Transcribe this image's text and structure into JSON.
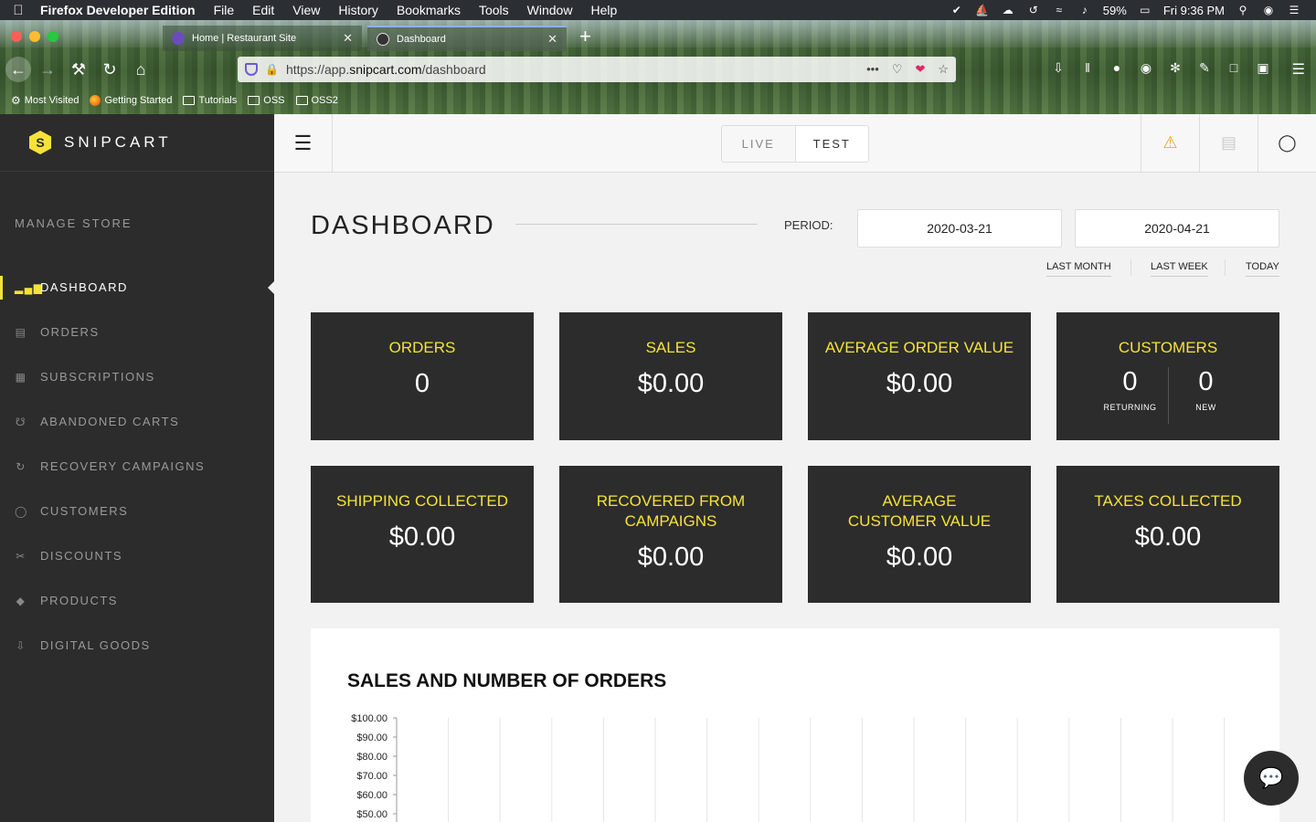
{
  "menubar": {
    "app_name": "Firefox Developer Edition",
    "menus": [
      "File",
      "Edit",
      "View",
      "History",
      "Bookmarks",
      "Tools",
      "Window",
      "Help"
    ],
    "battery": "59%",
    "clock": "Fri 9:36 PM"
  },
  "browser": {
    "tabs": [
      {
        "title": "Home | Restaurant Site",
        "active": false
      },
      {
        "title": "Dashboard",
        "active": true
      }
    ],
    "url_prefix": "https://app.",
    "url_domain": "snipcart.com",
    "url_path": "/dashboard",
    "bookmarks": [
      "Most Visited",
      "Getting Started",
      "Tutorials",
      "OSS",
      "OSS2"
    ]
  },
  "brand": {
    "name": "SNIPCART"
  },
  "sidebar": {
    "section": "MANAGE STORE",
    "items": [
      {
        "label": "DASHBOARD",
        "icon": "bar-chart-icon"
      },
      {
        "label": "ORDERS",
        "icon": "receipt-icon"
      },
      {
        "label": "SUBSCRIPTIONS",
        "icon": "calendar-icon"
      },
      {
        "label": "ABANDONED CARTS",
        "icon": "cart-icon"
      },
      {
        "label": "RECOVERY CAMPAIGNS",
        "icon": "refresh-icon"
      },
      {
        "label": "CUSTOMERS",
        "icon": "user-icon"
      },
      {
        "label": "DISCOUNTS",
        "icon": "scissors-icon"
      },
      {
        "label": "PRODUCTS",
        "icon": "tag-icon"
      },
      {
        "label": "DIGITAL GOODS",
        "icon": "download-icon"
      }
    ]
  },
  "topbar": {
    "mode_live": "LIVE",
    "mode_test": "TEST",
    "selected_mode": "TEST"
  },
  "dashboard": {
    "title": "DASHBOARD",
    "period_label": "PERIOD:",
    "start_date": "2020-03-21",
    "end_date": "2020-04-21",
    "quick_ranges": [
      "LAST MONTH",
      "LAST WEEK",
      "TODAY"
    ],
    "cards": {
      "orders": {
        "label": "ORDERS",
        "value": "0"
      },
      "sales": {
        "label": "SALES",
        "value": "$0.00"
      },
      "avg_order": {
        "label": "AVERAGE ORDER VALUE",
        "value": "$0.00"
      },
      "customers": {
        "label": "CUSTOMERS",
        "returning": "0",
        "returning_label": "RETURNING",
        "new": "0",
        "new_label": "NEW"
      },
      "shipping": {
        "label": "SHIPPING COLLECTED",
        "value": "$0.00"
      },
      "recovered": {
        "label": "RECOVERED FROM CAMPAIGNS",
        "value": "$0.00"
      },
      "avg_customer": {
        "label": "AVERAGE CUSTOMER VALUE",
        "value": "$0.00"
      },
      "taxes": {
        "label": "TAXES COLLECTED",
        "value": "$0.00"
      }
    }
  },
  "chart_data": {
    "type": "bar",
    "title": "SALES AND NUMBER OF ORDERS",
    "y_ticks": [
      "$100.00",
      "$90.00",
      "$80.00",
      "$70.00",
      "$60.00",
      "$50.00"
    ],
    "ylim": [
      50,
      100
    ],
    "values": [],
    "grid": true
  },
  "colors": {
    "accent": "#f5e33a",
    "sidebar_bg": "#2c2c2c",
    "card_bg": "#2c2c2c",
    "warning": "#f0a020"
  }
}
